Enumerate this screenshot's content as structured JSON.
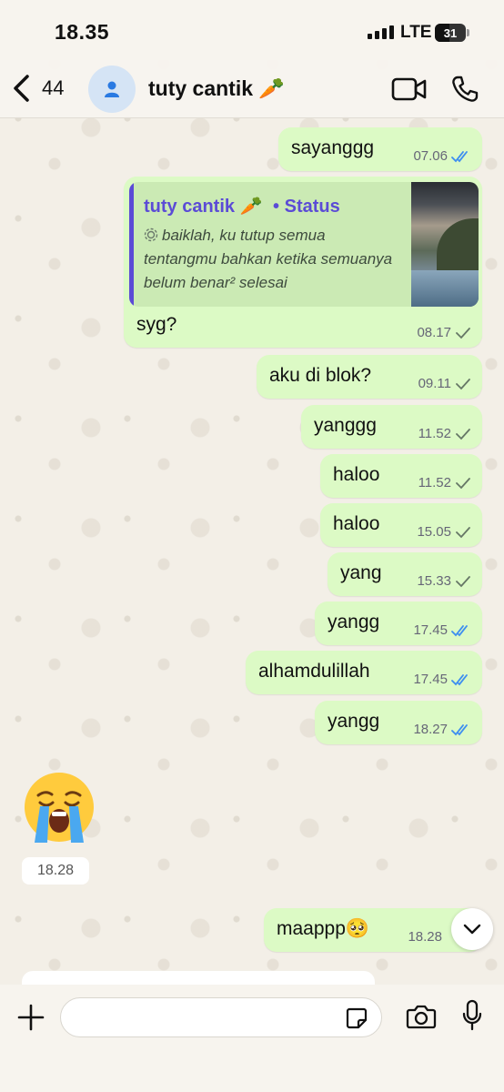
{
  "status_bar": {
    "time": "18.35",
    "network": "LTE",
    "battery": "31"
  },
  "header": {
    "back_count": "44",
    "contact_name": "tuty cantik 🥕",
    "icons": [
      "chevron-left-icon",
      "person-icon",
      "video-call-icon",
      "phone-icon"
    ]
  },
  "messages": [
    {
      "text": "sayanggg",
      "time": "07.06",
      "status": "read"
    },
    {
      "text": "syg?",
      "time": "08.17",
      "status": "delivered",
      "reply": {
        "name": "tuty cantik 🥕",
        "label": "• Status",
        "text": "baiklah, ku tutup semua tentangmu bahkan ketika semuanya belum benar² selesai"
      }
    },
    {
      "text": "aku di blok?",
      "time": "09.11",
      "status": "delivered"
    },
    {
      "text": "yanggg",
      "time": "11.52",
      "status": "delivered"
    },
    {
      "text": "haloo",
      "time": "11.52",
      "status": "delivered"
    },
    {
      "text": "haloo",
      "time": "15.05",
      "status": "delivered"
    },
    {
      "text": "yang",
      "time": "15.33",
      "status": "delivered"
    },
    {
      "text": "yangg",
      "time": "17.45",
      "status": "read"
    },
    {
      "text": "alhamdulillah",
      "time": "17.45",
      "status": "read"
    },
    {
      "text": "yangg",
      "time": "18.27",
      "status": "read"
    }
  ],
  "incoming": {
    "emoji": "😭",
    "time": "18.28"
  },
  "last_message": {
    "text": "maappp🥺",
    "time": "18.28"
  },
  "colors": {
    "outgoing_bubble": "#dcfac5",
    "read_tick": "#3d8ef0",
    "delivered_tick": "#667766",
    "status_accent": "#5b4bd6"
  }
}
